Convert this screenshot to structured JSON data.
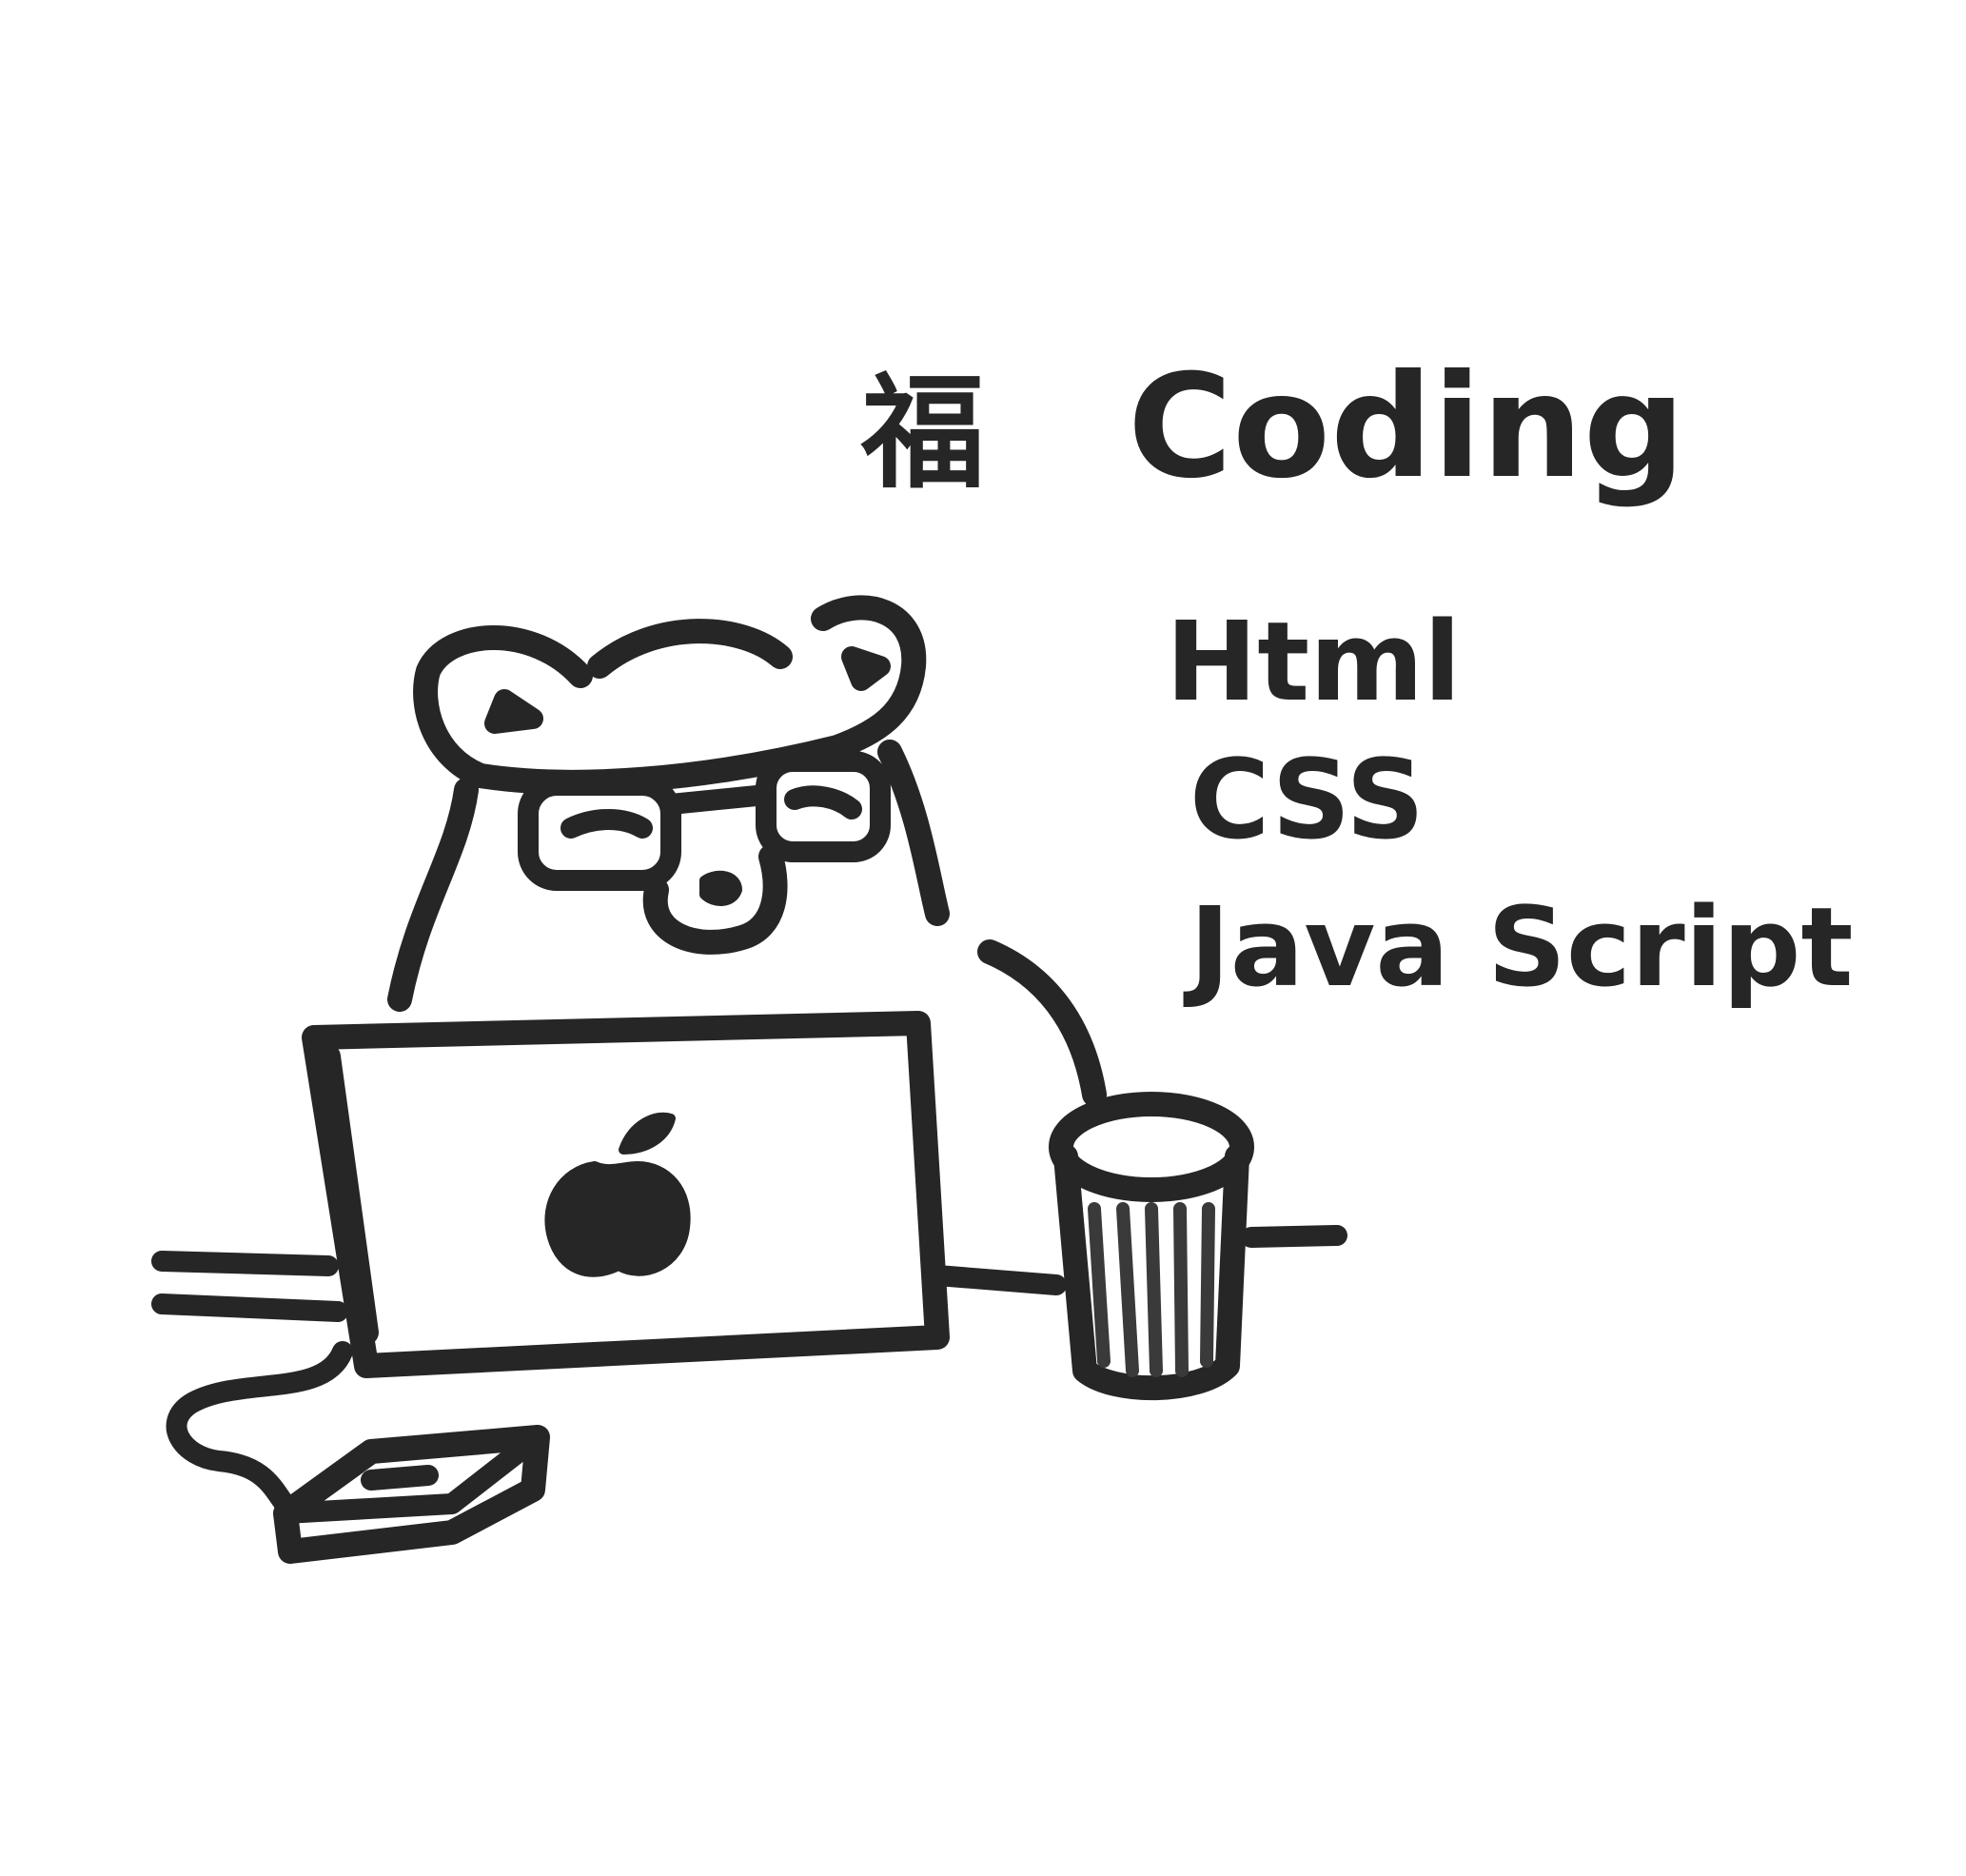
{
  "heading": {
    "glyph": "福",
    "word": "Coding"
  },
  "skills": [
    "Html",
    "CSS",
    "Java Script"
  ],
  "palette": {
    "ink": "#262626",
    "paper": "#ffffff"
  }
}
